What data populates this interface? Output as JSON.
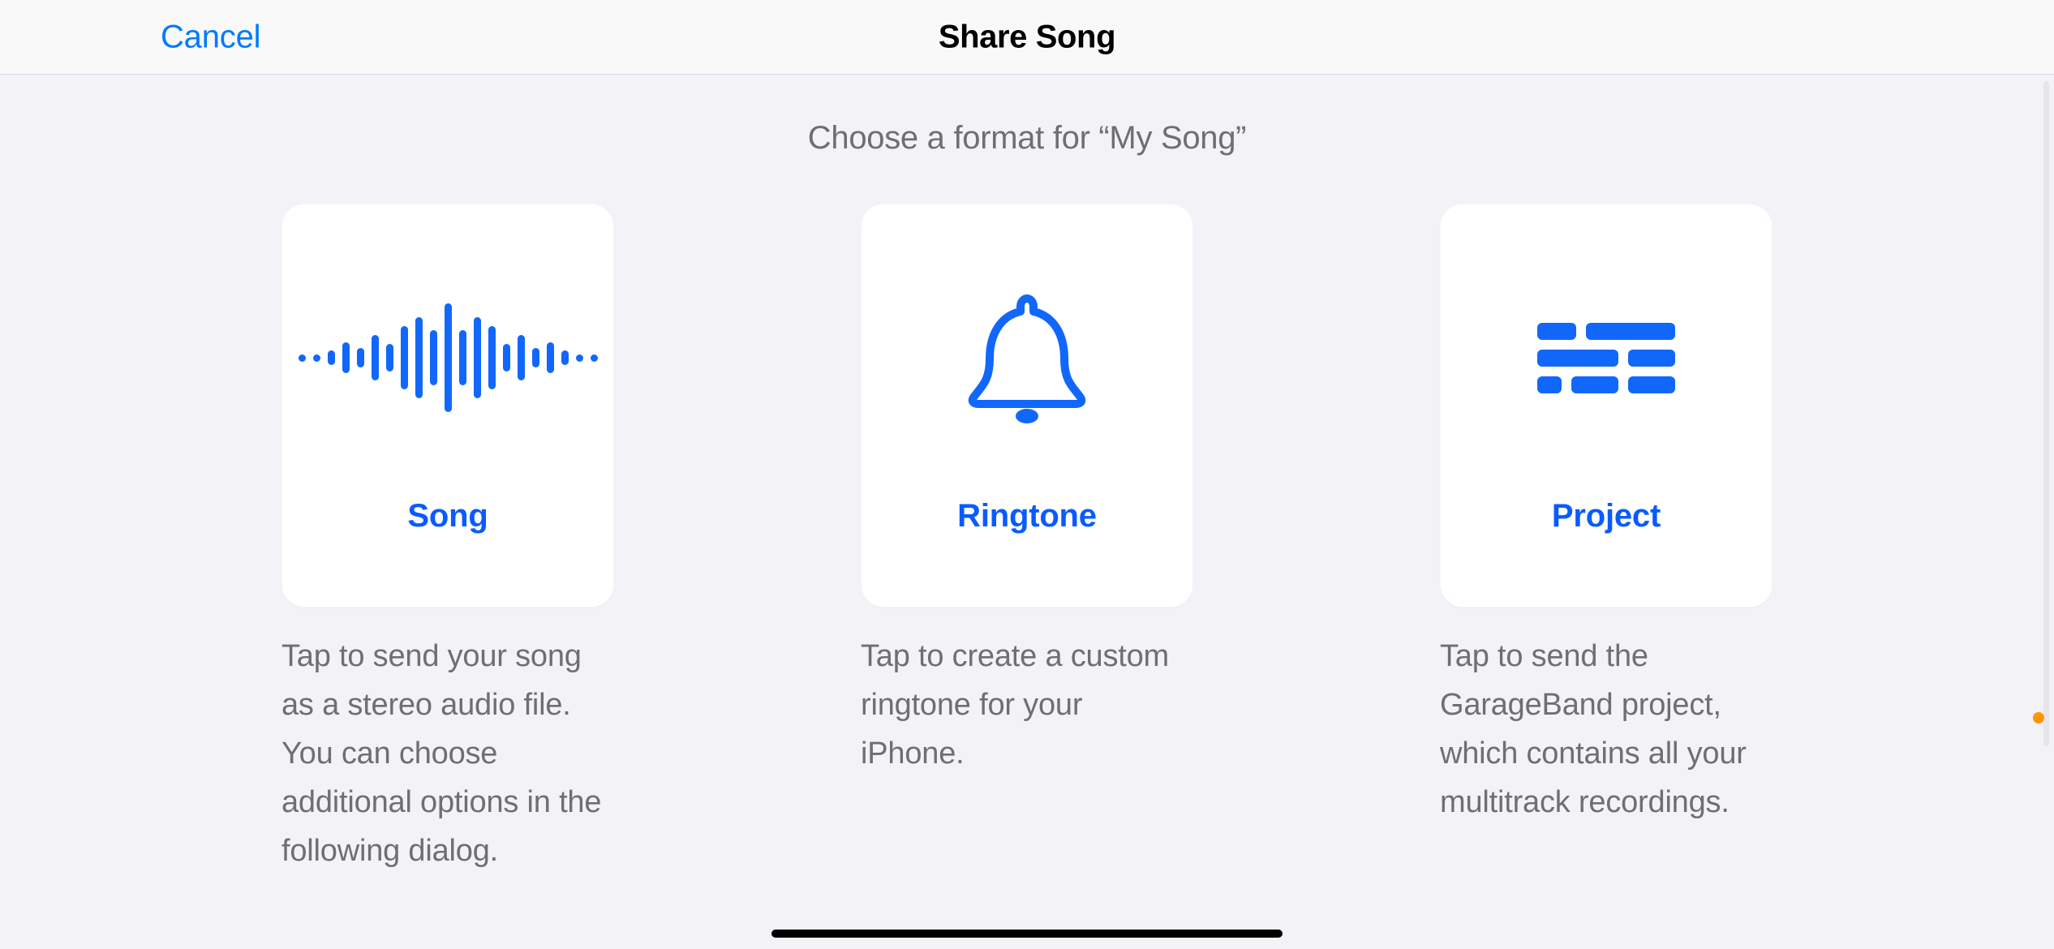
{
  "header": {
    "cancel_label": "Cancel",
    "title": "Share Song"
  },
  "main": {
    "subtitle": "Choose a format for “My Song”"
  },
  "cards": [
    {
      "key": "song",
      "label": "Song",
      "description": "Tap to send your song as a stereo audio file. You can choose additional options in the following dialog.",
      "icon": "waveform-icon"
    },
    {
      "key": "ringtone",
      "label": "Ringtone",
      "description": "Tap to create a custom ringtone for your iPhone.",
      "icon": "bell-icon"
    },
    {
      "key": "project",
      "label": "Project",
      "description": "Tap to send the GarageBand project, which contains all your multitrack recordings.",
      "icon": "multitrack-icon"
    }
  ],
  "colors": {
    "accent": "#1267fb",
    "link": "#007aff",
    "text_secondary": "#6e6e73",
    "card_bg": "#ffffff",
    "page_bg": "#f2f2f7"
  }
}
